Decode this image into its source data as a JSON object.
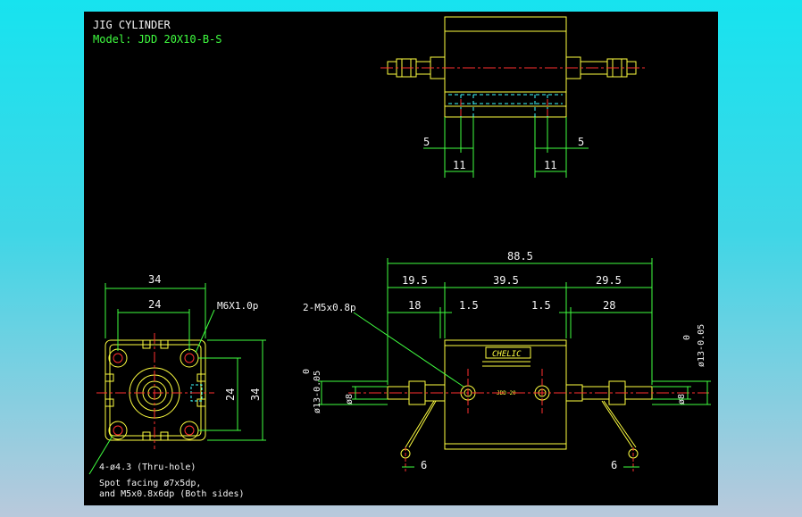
{
  "title": "JIG CYLINDER",
  "model": "Model:  JDD 20X10-B-S",
  "top_view": {
    "dims": [
      "5",
      "11",
      "11",
      "5"
    ]
  },
  "front_view": {
    "dims": [
      "34",
      "24",
      "24",
      "34"
    ],
    "thread_label": "M6X1.0p",
    "hole_label": "4-ø4.3 (Thru-hole)",
    "note_line1": "Spot facing  ø7x5dp,",
    "note_line2": "and  M5x0.8x6dp (Both sides)"
  },
  "side_view": {
    "overall": "88.5",
    "seg_a": "19.5",
    "seg_b": "39.5",
    "seg_c": "29.5",
    "d18": "18",
    "d15a": "1.5",
    "d15b": "1.5",
    "d28": "28",
    "port_label": "2-M5x0.8p",
    "dia_left_1": "0",
    "dia_left_2": "ø13-0.05",
    "dia_left_3": "ø8",
    "dia_right_1": "0",
    "dia_right_2": "ø13-0.05",
    "dia_right_3": "ø8",
    "d6a": "6",
    "d6b": "6",
    "brand": "CHELIC",
    "plate_text": "JDD 20"
  }
}
